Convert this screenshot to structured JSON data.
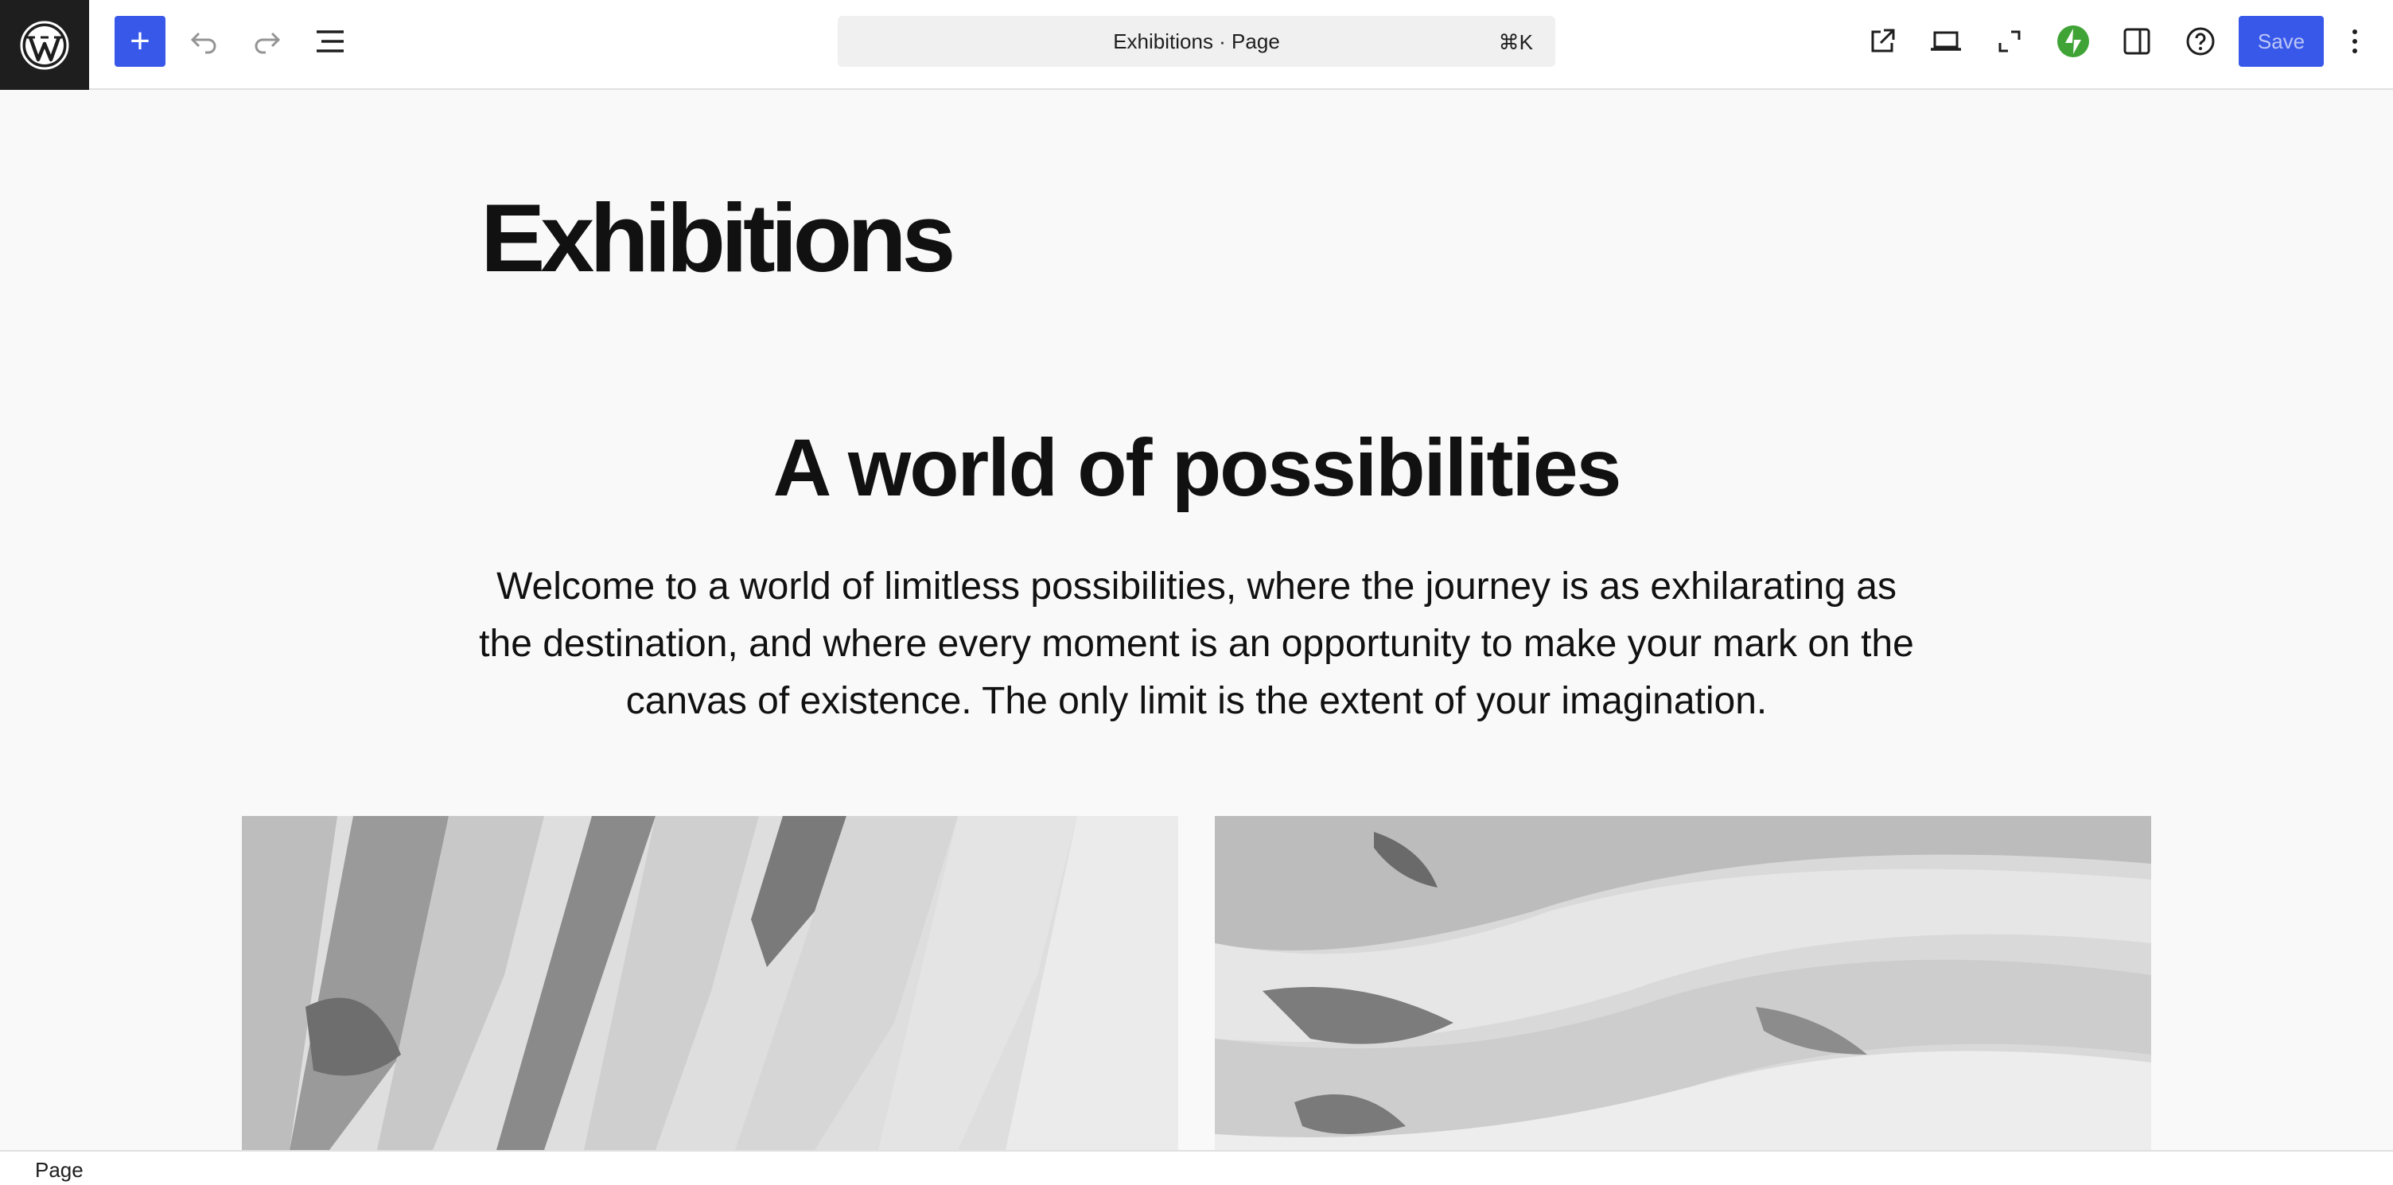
{
  "toolbar": {
    "logo": "wordpress-logo",
    "add_block": "+",
    "command_title": "Exhibitions · Page",
    "command_shortcut": "⌘K",
    "save_label": "Save"
  },
  "content": {
    "page_title": "Exhibitions",
    "heading": "A world of possibilities",
    "paragraph": "Welcome to a world of limitless possibilities, where the journey is as exhilarating as the destination, and where every moment is an opportunity to make your mark on the canvas of existence. The only limit is the extent of your imagination."
  },
  "statusbar": {
    "breadcrumb": "Page"
  },
  "colors": {
    "accent": "#3858e9",
    "jetpack": "#3fa336",
    "logo_bg": "#1e1e1e"
  }
}
